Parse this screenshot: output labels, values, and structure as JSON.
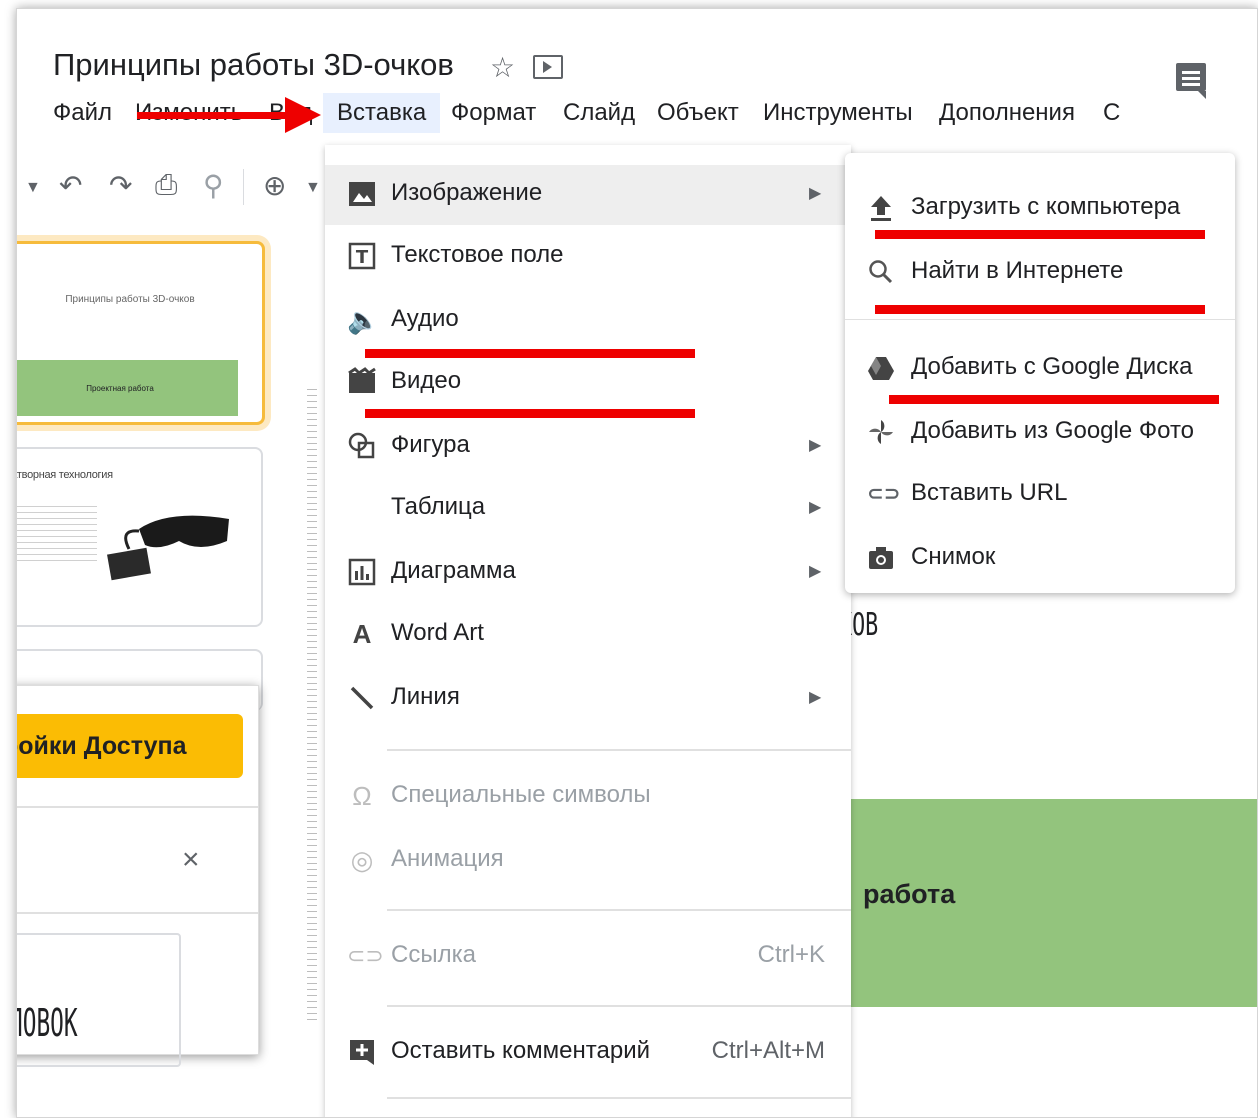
{
  "doc": {
    "title": "Принципы работы  3D-очков"
  },
  "menubar": {
    "items": [
      "Файл",
      "Изменить",
      "Вид",
      "Вставка",
      "Формат",
      "Слайд",
      "Объект",
      "Инструменты",
      "Дополнения",
      "С"
    ]
  },
  "filmstrip": {
    "slide1_title": "Принципы работы 3D-очков",
    "slide1_footer": "Проектная работа",
    "slide2_title": "Затворная технология"
  },
  "canvas": {
    "kob_text": "КОВ",
    "green_text": "работа"
  },
  "dialog": {
    "button_label": "ройки Доступа",
    "close_glyph": "×",
    "box_text": "ЛОВОК"
  },
  "insert_menu": {
    "items": [
      {
        "label": "Изображение",
        "icon": "image-icon",
        "submenu": true
      },
      {
        "label": "Текстовое поле",
        "icon": "text-box-icon"
      },
      {
        "label": "Аудио",
        "icon": "audio-icon"
      },
      {
        "label": "Видео",
        "icon": "video-icon"
      },
      {
        "label": "Фигура",
        "icon": "shape-icon",
        "submenu": true
      },
      {
        "label": "Таблица",
        "icon": "",
        "submenu": true
      },
      {
        "label": "Диаграмма",
        "icon": "chart-icon",
        "submenu": true
      },
      {
        "label": "Word Art",
        "icon": "word-art-icon"
      },
      {
        "label": "Линия",
        "icon": "line-icon",
        "submenu": true
      },
      {
        "label": "Специальные символы",
        "icon": "omega-icon",
        "disabled": true
      },
      {
        "label": "Анимация",
        "icon": "animation-icon",
        "disabled": true
      },
      {
        "label": "Ссылка",
        "icon": "link-icon",
        "shortcut": "Ctrl+K",
        "disabled": true
      },
      {
        "label": "Оставить комментарий",
        "icon": "add-comment-icon",
        "shortcut": "Ctrl+Alt+M"
      }
    ]
  },
  "image_submenu": {
    "items": [
      {
        "label": "Загрузить с компьютера",
        "icon": "upload-icon"
      },
      {
        "label": "Найти в Интернете",
        "icon": "search-icon"
      },
      {
        "label": "Добавить с Google Диска",
        "icon": "google-drive-icon"
      },
      {
        "label": "Добавить из Google Фото",
        "icon": "google-photos-icon"
      },
      {
        "label": "Вставить URL",
        "icon": "link-icon"
      },
      {
        "label": "Снимок",
        "icon": "camera-icon"
      }
    ]
  },
  "colors": {
    "annotation_red": "#ee0000",
    "accent_yellow": "#fbbc04",
    "slide_green": "#93c47d",
    "menu_hover": "#eeeeee"
  }
}
